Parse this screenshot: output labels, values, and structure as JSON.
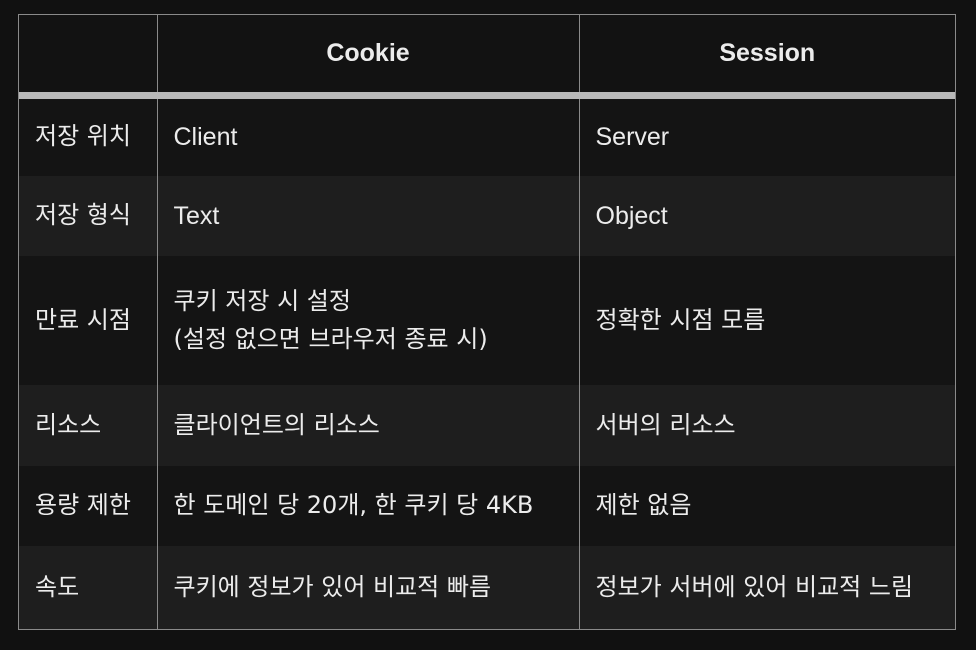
{
  "header": {
    "corner": "",
    "cookie": "Cookie",
    "session": "Session"
  },
  "rows": [
    {
      "label": "저장 위치",
      "cookie": "Client",
      "session": "Server"
    },
    {
      "label": "저장 형식",
      "cookie": "Text",
      "session": "Object"
    },
    {
      "label": "만료 시점",
      "cookie_line1": "쿠키 저장 시 설정",
      "cookie_line2": "(설정 없으면 브라우저 종료 시)",
      "session": "정확한 시점 모름"
    },
    {
      "label": "리소스",
      "cookie": "클라이언트의 리소스",
      "session": "서버의 리소스"
    },
    {
      "label": "용량 제한",
      "cookie": "한 도메인 당 20개, 한 쿠키 당 4KB",
      "session": "제한 없음"
    },
    {
      "label": "속도",
      "cookie": "쿠키에 정보가 있어 비교적 빠름",
      "session": "정보가 서버에 있어 비교적 느림"
    }
  ]
}
